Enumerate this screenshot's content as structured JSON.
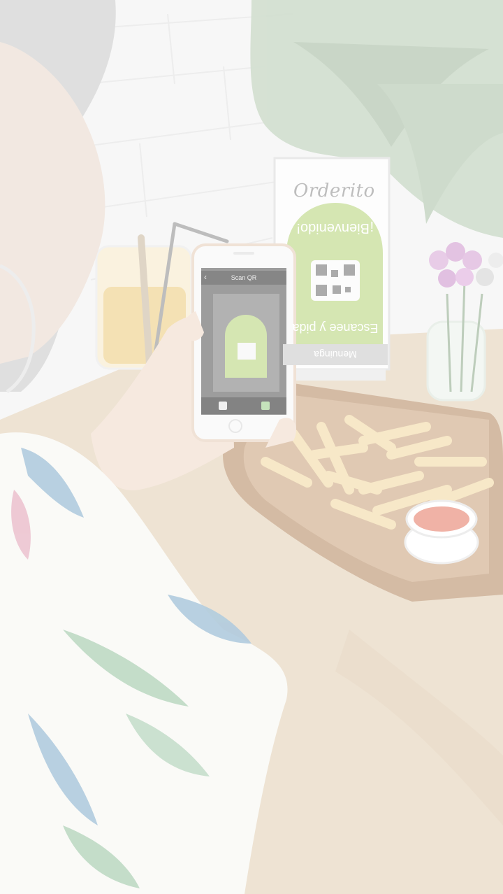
{
  "stand": {
    "brand": "Orderito",
    "footer": "Menuinga",
    "line1": "¡Bienvenido!",
    "line2": "Escanee y pida"
  },
  "phone": {
    "title": "Scan QR",
    "back": "‹"
  },
  "colors": {
    "wash": "#ffffff",
    "accent": "#b7d47a"
  }
}
